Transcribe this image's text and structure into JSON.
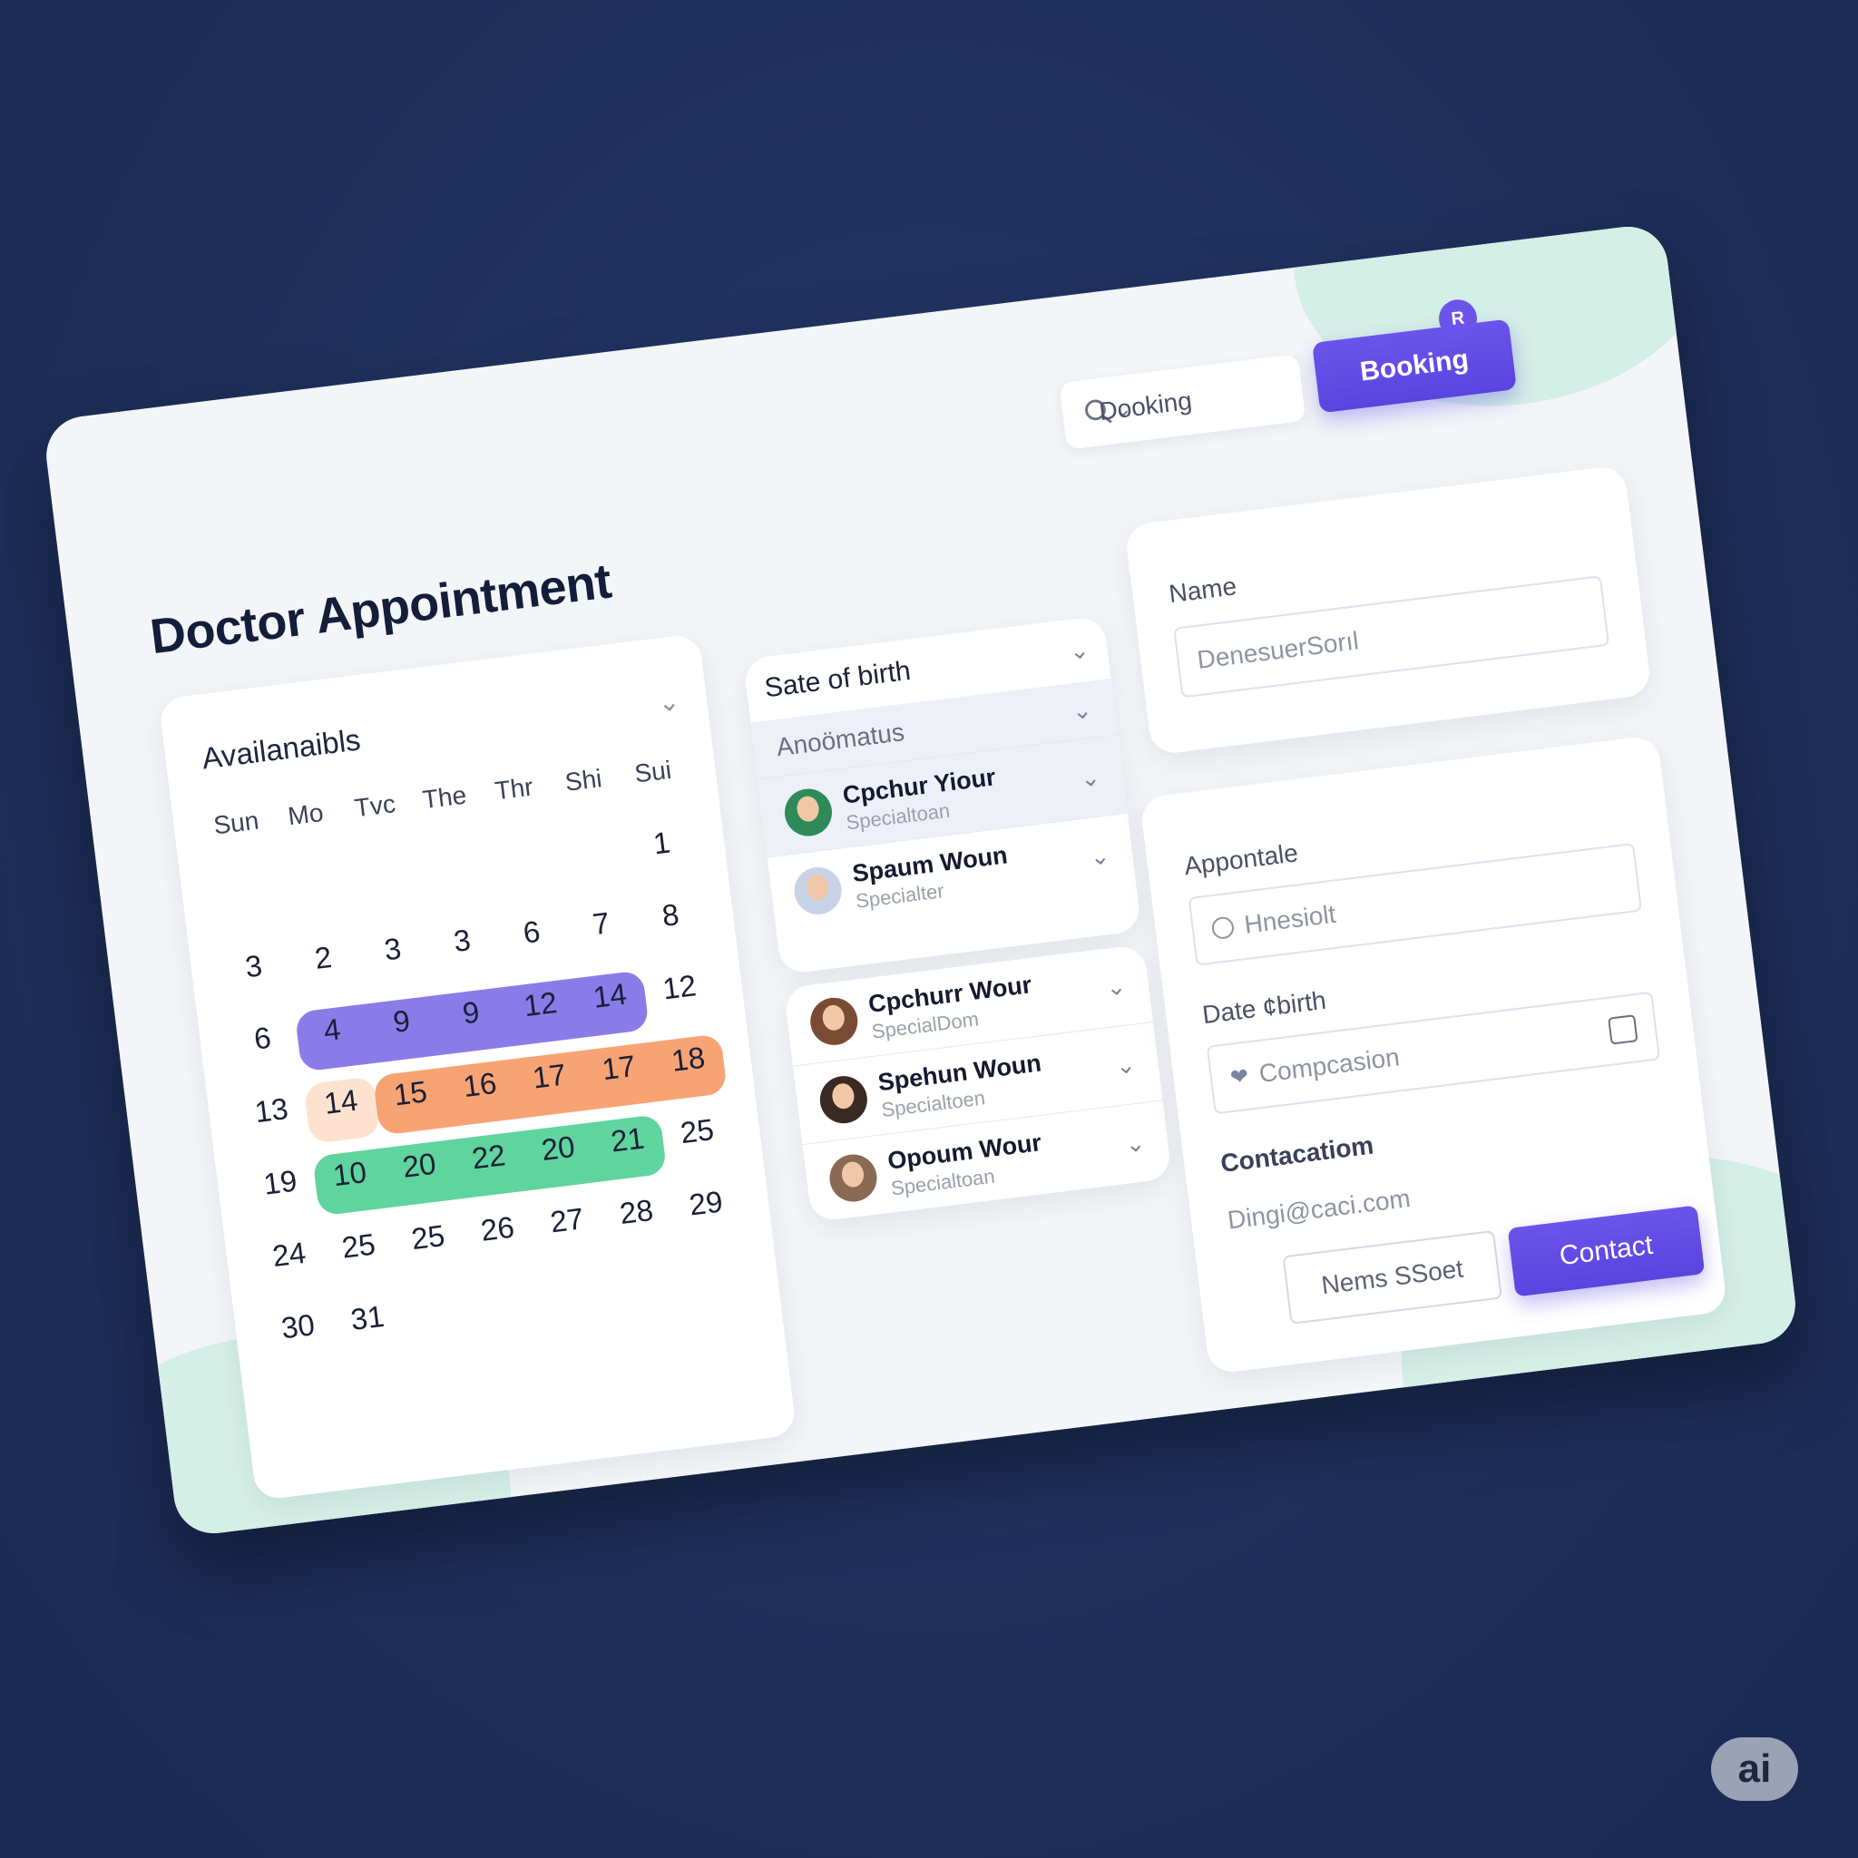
{
  "app": {
    "title": "Doctor Appointment"
  },
  "header": {
    "search_label": "Dooking",
    "booking_label": "Booking",
    "badge_glyph": "R"
  },
  "calendar": {
    "title": "Availanaibls",
    "weekdays": [
      "Sun",
      "Mo",
      "Tvc",
      "The",
      "Thr",
      "Shi",
      "Sui"
    ],
    "rows": [
      [
        "",
        "",
        "",
        "",
        "",
        "",
        "1"
      ],
      [
        "3",
        "2",
        "3",
        "3",
        "6",
        "7",
        "8"
      ],
      [
        "6",
        "4",
        "9",
        "9",
        "12",
        "14",
        "12"
      ],
      [
        "13",
        "14",
        "15",
        "16",
        "17",
        "17",
        "18"
      ],
      [
        "19",
        "10",
        "20",
        "22",
        "20",
        "21",
        "25"
      ],
      [
        "24",
        "25",
        "25",
        "26",
        "27",
        "28",
        "29"
      ],
      [
        "30",
        "31",
        "",
        "",
        "",
        "",
        ""
      ]
    ],
    "highlight_colors": {
      "purple": "#8a7ce8",
      "orange": "#f7a374",
      "peach": "#fde3cf",
      "green": "#5fd49e"
    }
  },
  "dropdown_top": {
    "header": "Sate of birth",
    "sub": "Anoömatus",
    "doctors": [
      {
        "name": "Cpchur Yiour",
        "specialty": "Specialtoan"
      },
      {
        "name": "Spaum Woun",
        "specialty": "Specialter"
      }
    ]
  },
  "dropdown_bottom": {
    "doctors": [
      {
        "name": "Cpchurr Wour",
        "specialty": "SpecialDom"
      },
      {
        "name": "Spehun Woun",
        "specialty": "Specialtoen"
      },
      {
        "name": "Opoum Wour",
        "specialty": "Specialtoan"
      }
    ]
  },
  "form_name": {
    "label": "Name",
    "value": "DenesuerSorıl"
  },
  "form_details": {
    "appointment_label": "Appontale",
    "appointment_value": "Hnesiolt",
    "dob_label": "Date ¢birth",
    "dob_value": "Compcasion",
    "contact_label": "Contacatiom",
    "email": "Dingi@caci.com",
    "secondary_button": "Nems SSoet",
    "primary_button": "Contact"
  },
  "watermark": "ai",
  "colors": {
    "accent": "#5a44e0",
    "background": "#1d2e59",
    "mint": "#d4efe6"
  }
}
